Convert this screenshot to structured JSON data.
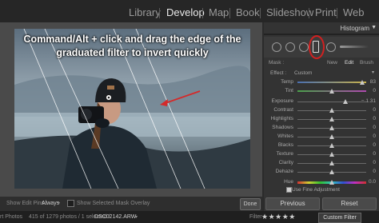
{
  "modules": [
    "Library",
    "Develop",
    "Map",
    "Book",
    "Slideshow",
    "Print",
    "Web"
  ],
  "active_module": "Develop",
  "overlay": {
    "line1": "Command/Alt + click and drag the edge of the",
    "line2": "graduated filter to invert quickly"
  },
  "toolbar": {
    "show_edit_pins_label": "Show Edit Pins :",
    "show_edit_pins_value": "Always",
    "mask_overlay_label": "Show Selected Mask Overlay",
    "done_label": "Done"
  },
  "filmstrip": {
    "left_text": "rt Photos",
    "count_text": "415 of 1279 photos / 1 selected /",
    "filename": "DSC02142.ARW",
    "filter_label": "Filter :",
    "stars": "★★★★★",
    "custom_filter": "Custom Filter"
  },
  "panel": {
    "histogram_title": "Histogram",
    "mask_label": "Mask :",
    "mask_new": "New",
    "mask_edit": "Edit",
    "mask_brush": "Brush",
    "effect_label": "Effect :",
    "effect_value": "Custom",
    "sliders": [
      {
        "label": "Temp",
        "value": "83",
        "pos": 0.94
      },
      {
        "label": "Tint",
        "value": "0",
        "pos": 0.5
      },
      {
        "label": "Exposure",
        "value": "− 1.31",
        "pos": 0.7
      },
      {
        "label": "Contrast",
        "value": "0",
        "pos": 0.5
      },
      {
        "label": "Highlights",
        "value": "0",
        "pos": 0.5
      },
      {
        "label": "Shadows",
        "value": "0",
        "pos": 0.5
      },
      {
        "label": "Whites",
        "value": "0",
        "pos": 0.5
      },
      {
        "label": "Blacks",
        "value": "0",
        "pos": 0.5
      },
      {
        "label": "Texture",
        "value": "0",
        "pos": 0.5
      },
      {
        "label": "Clarity",
        "value": "0",
        "pos": 0.5
      },
      {
        "label": "Dehaze",
        "value": "0",
        "pos": 0.5
      },
      {
        "label": "Hue",
        "value": "0.0",
        "pos": 0.5
      }
    ],
    "use_fine_adjustment": "Use Fine Adjustment",
    "previous_label": "Previous",
    "reset_label": "Reset"
  }
}
